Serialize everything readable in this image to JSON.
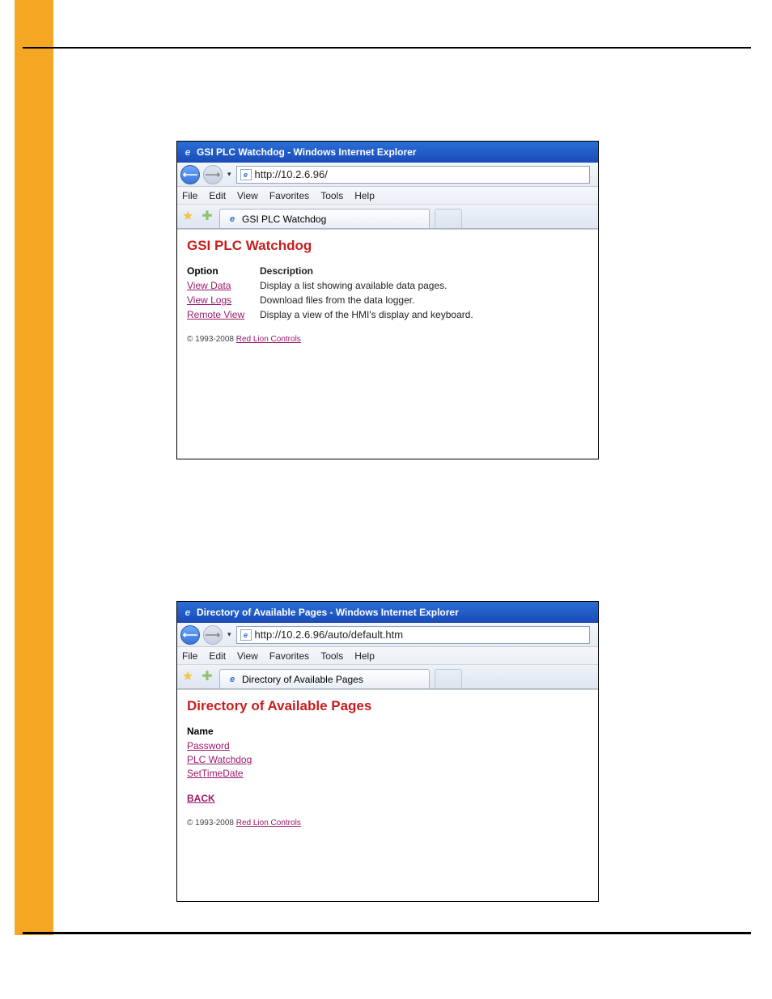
{
  "menus": [
    "File",
    "Edit",
    "View",
    "Favorites",
    "Tools",
    "Help"
  ],
  "copyright_prefix": "© 1993-2008 ",
  "copyright_link": "Red Lion Controls",
  "win1": {
    "title": "GSI PLC Watchdog - Windows Internet Explorer",
    "url": "http://10.2.6.96/",
    "tab": "GSI PLC Watchdog",
    "heading": "GSI PLC Watchdog",
    "col1": "Option",
    "col2": "Description",
    "rows": [
      {
        "opt": "View Data",
        "desc": "Display a list showing available data pages."
      },
      {
        "opt": "View Logs",
        "desc": "Download files from the data logger."
      },
      {
        "opt": "Remote View",
        "desc": "Display a view of the HMI's display and keyboard."
      }
    ]
  },
  "win2": {
    "title": "Directory of Available Pages - Windows Internet Explorer",
    "url": "http://10.2.6.96/auto/default.htm",
    "tab": "Directory of Available Pages",
    "heading": "Directory of Available Pages",
    "name_hdr": "Name",
    "items": [
      "Password",
      "PLC Watchdog",
      "SetTimeDate"
    ],
    "back": "BACK"
  }
}
